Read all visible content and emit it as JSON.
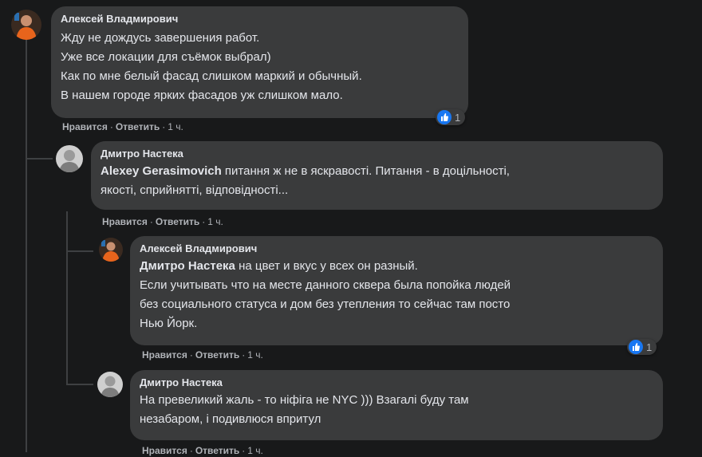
{
  "comments": [
    {
      "author": "Алексей Владмирович",
      "mention": "",
      "lines": [
        "Жду не дождусь завершения работ.",
        "Уже все локации для съёмок выбрал)",
        "Как по мне белый фасад слишком маркий и обычный.",
        "В нашем городе ярких фасадов уж слишком мало."
      ],
      "like_label": "Нравится",
      "reply_label": "Ответить",
      "time": "1 ч.",
      "reactions": "1"
    },
    {
      "author": "Дмитро Настека",
      "mention": "Alexey Gerasimovich",
      "lines": [
        " питання ж не в яскравості. Питання - в доцільності,",
        "якості, сприйнятті, відповідності..."
      ],
      "like_label": "Нравится",
      "reply_label": "Ответить",
      "time": "1 ч."
    },
    {
      "author": "Алексей Владмирович",
      "mention": "Дмитро Настека",
      "lines": [
        " на цвет и вкус у всех он разный.",
        "Если учитывать что на месте данного сквера была попойка людей",
        "без социального статуса и дом без утепления то сейчас там посто",
        "Нью Йорк."
      ],
      "like_label": "Нравится",
      "reply_label": "Ответить",
      "time": "1 ч.",
      "reactions": "1"
    },
    {
      "author": "Дмитро Настека",
      "mention": "",
      "lines": [
        "На превеликий жаль - то ніфіга не NYC ))) Взагалі буду там",
        "незабаром, і подивлюся впритул"
      ],
      "like_label": "Нравится",
      "reply_label": "Ответить",
      "time": "1 ч."
    }
  ],
  "separator": "·",
  "colors": {
    "background": "#18191a",
    "bubble": "#3a3b3c",
    "text": "#e4e6eb",
    "secondary_text": "#b0b3b8",
    "like_blue": "#1877f2"
  }
}
